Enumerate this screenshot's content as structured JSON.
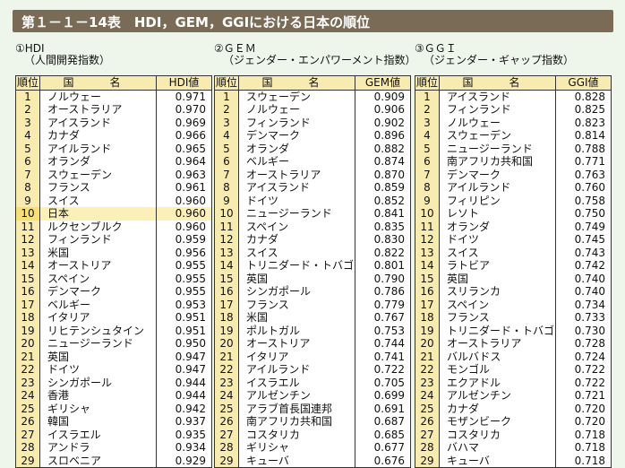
{
  "title": "第１－１－14表　HDI，GEM，GGIにおける日本の順位",
  "header": {
    "rank": "順位",
    "country": "国　名"
  },
  "tables": [
    {
      "caption1": "①HDI",
      "caption2": "（人間開発指数）",
      "value_header": "HDI値",
      "rows": [
        [
          "1",
          "ノルウェー",
          "0.971"
        ],
        [
          "2",
          "オーストラリア",
          "0.970"
        ],
        [
          "3",
          "アイスランド",
          "0.969"
        ],
        [
          "4",
          "カナダ",
          "0.966"
        ],
        [
          "5",
          "アイルランド",
          "0.965"
        ],
        [
          "6",
          "オランダ",
          "0.964"
        ],
        [
          "7",
          "スウェーデン",
          "0.963"
        ],
        [
          "8",
          "フランス",
          "0.961"
        ],
        [
          "9",
          "スイス",
          "0.960"
        ],
        [
          "10",
          "日本",
          "0.960"
        ],
        [
          "11",
          "ルクセンブルク",
          "0.960"
        ],
        [
          "12",
          "フィンランド",
          "0.959"
        ],
        [
          "13",
          "米国",
          "0.956"
        ],
        [
          "14",
          "オーストリア",
          "0.955"
        ],
        [
          "15",
          "スペイン",
          "0.955"
        ],
        [
          "16",
          "デンマーク",
          "0.955"
        ],
        [
          "17",
          "ベルギー",
          "0.953"
        ],
        [
          "18",
          "イタリア",
          "0.951"
        ],
        [
          "19",
          "リヒテンシュタイン",
          "0.951"
        ],
        [
          "20",
          "ニュージーランド",
          "0.950"
        ],
        [
          "21",
          "英国",
          "0.947"
        ],
        [
          "22",
          "ドイツ",
          "0.947"
        ],
        [
          "23",
          "シンガポール",
          "0.944"
        ],
        [
          "24",
          "香港",
          "0.944"
        ],
        [
          "25",
          "ギリシャ",
          "0.942"
        ],
        [
          "26",
          "韓国",
          "0.937"
        ],
        [
          "27",
          "イスラエル",
          "0.935"
        ],
        [
          "28",
          "アンドラ",
          "0.934"
        ],
        [
          "29",
          "スロベニア",
          "0.929"
        ]
      ]
    },
    {
      "caption1": "②ＧＥＭ",
      "caption2": "（ジェンダー・エンパワーメント指数）",
      "value_header": "GEM値",
      "rows": [
        [
          "1",
          "スウェーデン",
          "0.909"
        ],
        [
          "2",
          "ノルウェー",
          "0.906"
        ],
        [
          "3",
          "フィンランド",
          "0.902"
        ],
        [
          "4",
          "デンマーク",
          "0.896"
        ],
        [
          "5",
          "オランダ",
          "0.882"
        ],
        [
          "6",
          "ベルギー",
          "0.874"
        ],
        [
          "7",
          "オーストラリア",
          "0.870"
        ],
        [
          "8",
          "アイスランド",
          "0.859"
        ],
        [
          "9",
          "ドイツ",
          "0.852"
        ],
        [
          "10",
          "ニュージーランド",
          "0.841"
        ],
        [
          "11",
          "スペイン",
          "0.835"
        ],
        [
          "12",
          "カナダ",
          "0.830"
        ],
        [
          "13",
          "スイス",
          "0.822"
        ],
        [
          "14",
          "トリニダード・トバゴ",
          "0.801"
        ],
        [
          "15",
          "英国",
          "0.790"
        ],
        [
          "16",
          "シンガポール",
          "0.786"
        ],
        [
          "17",
          "フランス",
          "0.779"
        ],
        [
          "18",
          "米国",
          "0.767"
        ],
        [
          "19",
          "ポルトガル",
          "0.753"
        ],
        [
          "20",
          "オーストリア",
          "0.744"
        ],
        [
          "21",
          "イタリア",
          "0.741"
        ],
        [
          "22",
          "アイルランド",
          "0.722"
        ],
        [
          "23",
          "イスラエル",
          "0.705"
        ],
        [
          "24",
          "アルゼンチン",
          "0.699"
        ],
        [
          "25",
          "アラブ首長国連邦",
          "0.691"
        ],
        [
          "26",
          "南アフリカ共和国",
          "0.687"
        ],
        [
          "27",
          "コスタリカ",
          "0.685"
        ],
        [
          "28",
          "ギリシャ",
          "0.677"
        ],
        [
          "29",
          "キューバ",
          "0.676"
        ]
      ]
    },
    {
      "caption1": "③ＧＧＩ",
      "caption2": "（ジェンダー・ギャップ指数）",
      "value_header": "GGI値",
      "rows": [
        [
          "1",
          "アイスランド",
          "0.828"
        ],
        [
          "2",
          "フィンランド",
          "0.825"
        ],
        [
          "3",
          "ノルウェー",
          "0.823"
        ],
        [
          "4",
          "スウェーデン",
          "0.814"
        ],
        [
          "5",
          "ニュージーランド",
          "0.788"
        ],
        [
          "6",
          "南アフリカ共和国",
          "0.771"
        ],
        [
          "7",
          "デンマーク",
          "0.763"
        ],
        [
          "8",
          "アイルランド",
          "0.760"
        ],
        [
          "9",
          "フィリピン",
          "0.758"
        ],
        [
          "10",
          "レソト",
          "0.750"
        ],
        [
          "11",
          "オランダ",
          "0.749"
        ],
        [
          "12",
          "ドイツ",
          "0.745"
        ],
        [
          "13",
          "スイス",
          "0.743"
        ],
        [
          "14",
          "ラトビア",
          "0.742"
        ],
        [
          "15",
          "英国",
          "0.740"
        ],
        [
          "16",
          "スリランカ",
          "0.740"
        ],
        [
          "17",
          "スペイン",
          "0.734"
        ],
        [
          "18",
          "フランス",
          "0.733"
        ],
        [
          "19",
          "トリニダード・トバゴ",
          "0.730"
        ],
        [
          "20",
          "オーストラリア",
          "0.728"
        ],
        [
          "21",
          "バルバドス",
          "0.724"
        ],
        [
          "22",
          "モンゴル",
          "0.722"
        ],
        [
          "23",
          "エクアドル",
          "0.722"
        ],
        [
          "24",
          "アルゼンチン",
          "0.721"
        ],
        [
          "25",
          "カナダ",
          "0.720"
        ],
        [
          "26",
          "モザンビーク",
          "0.720"
        ],
        [
          "27",
          "コスタリカ",
          "0.718"
        ],
        [
          "28",
          "バハマ",
          "0.718"
        ],
        [
          "29",
          "キューバ",
          "0.718"
        ]
      ]
    }
  ],
  "highlight": {
    "table": 0,
    "rank": "10"
  },
  "colors": {
    "title_bg": "#7a6b57",
    "rank_col_bg": "#f8ebb0",
    "highlight_row": "#fbf0b8",
    "page_bg": "#eef5ea"
  }
}
